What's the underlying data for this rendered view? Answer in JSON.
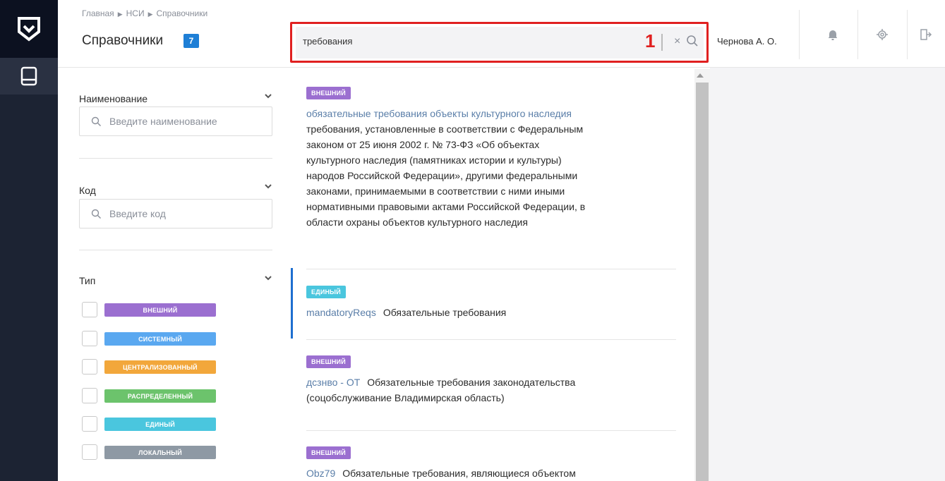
{
  "header": {
    "breadcrumb": [
      "Главная",
      "НСИ",
      "Справочники"
    ],
    "title": "Справочники",
    "count_badge": "7",
    "search": {
      "value": "требования",
      "annotation": "1"
    },
    "user": "Чернова А. О."
  },
  "filters": {
    "name": {
      "label": "Наименование",
      "placeholder": "Введите наименование"
    },
    "code": {
      "label": "Код",
      "placeholder": "Введите код"
    },
    "type": {
      "label": "Тип",
      "options": [
        {
          "label": "ВНЕШНИЙ",
          "color": "#9b6fd0"
        },
        {
          "label": "СИСТЕМНЫЙ",
          "color": "#5aa8f0"
        },
        {
          "label": "ЦЕНТРАЛИЗОВАННЫЙ",
          "color": "#f2a73b"
        },
        {
          "label": "РАСПРЕДЕЛЕННЫЙ",
          "color": "#6cc36c"
        },
        {
          "label": "ЕДИНЫЙ",
          "color": "#4ac6de"
        },
        {
          "label": "ЛОКАЛЬНЫЙ",
          "color": "#8e99a4"
        }
      ]
    }
  },
  "results": [
    {
      "tag": "ВНЕШНИЙ",
      "tag_color": "#9b6fd0",
      "code": "обязательные требования объекты культурного наследия",
      "lines": [
        "требования, установленные в соответствии с Федеральным",
        "законом от 25 июня 2002 г. № 73-ФЗ «Об объектах",
        "культурного наследия (памятниках истории и культуры)",
        "народов Российской Федерации», другими федеральными",
        "законами, принимаемыми в соответствии с ними иными",
        "нормативными правовыми актами Российской Федерации, в",
        "области охраны объектов культурного наследия"
      ]
    },
    {
      "tag": "ЕДИНЫЙ",
      "tag_color": "#4ac6de",
      "code": "mandatoryReqs",
      "name": "Обязательные требования"
    },
    {
      "tag": "ВНЕШНИЙ",
      "tag_color": "#9b6fd0",
      "code": "дсзнво - ОТ",
      "name": "Обязательные требования законодательства",
      "line2": "(соцобслуживание Владимирская область)"
    },
    {
      "tag": "ВНЕШНИЙ",
      "tag_color": "#9b6fd0",
      "code": "Obz79",
      "name": "Обязательные требования, являющиеся объектом"
    }
  ]
}
